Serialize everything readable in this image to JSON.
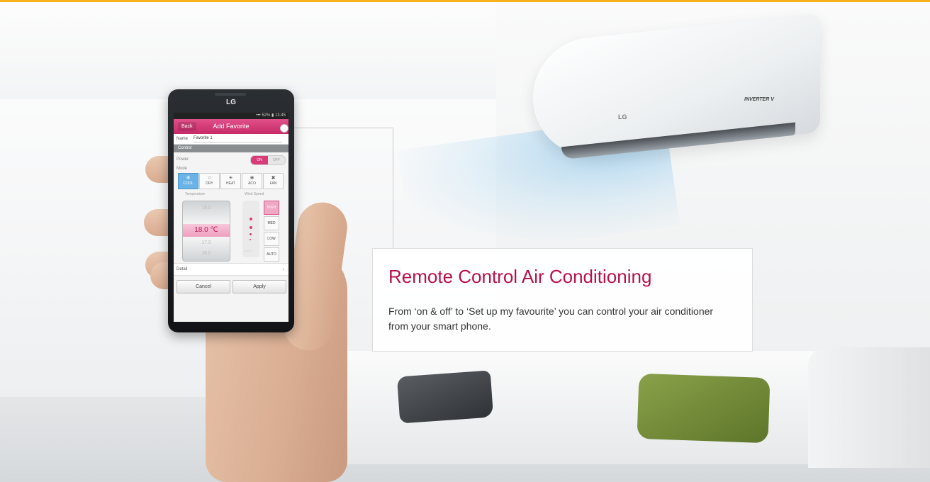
{
  "colors": {
    "top_bar": "#f6b11b",
    "accent": "#b8114a",
    "app_bar": "#d83b78",
    "mode_active": "#6bb3e6"
  },
  "air_conditioner": {
    "logo": "LG",
    "badge": "INVERTER V"
  },
  "info_panel": {
    "title": "Remote Control Air Conditioning",
    "description": "From ‘on & off’ to ‘Set up my favourite’ you can control your air conditioner  from your smart phone."
  },
  "phone": {
    "brand": "LG",
    "status": "••• 52% ▮ 13:45",
    "app_bar": {
      "back": "Back",
      "title": "Add Favorite"
    },
    "name": {
      "label": "Name",
      "value": "Favorite 1"
    },
    "section": "Control",
    "power": {
      "label": "Power",
      "on": "ON",
      "off": "OFF"
    },
    "mode": {
      "label": "Mode",
      "options": [
        {
          "label": "COOL",
          "icon": "snowflake-icon",
          "glyph": "❄"
        },
        {
          "label": "DRY",
          "icon": "droplet-icon",
          "glyph": "○"
        },
        {
          "label": "HEAT",
          "icon": "sun-icon",
          "glyph": "☀"
        },
        {
          "label": "ACO",
          "icon": "auto-icon",
          "glyph": "❀"
        },
        {
          "label": "FAN",
          "icon": "fan-icon",
          "glyph": "✖"
        }
      ],
      "selected": "COOL"
    },
    "temperature": {
      "label": "Temperature",
      "above": "19.0",
      "value": "18.0 ℃",
      "below": "17.0",
      "below2": "16.0"
    },
    "wind": {
      "label": "Wind Speed",
      "options": [
        "HIGH",
        "MED",
        "LOW",
        "AUTO"
      ],
      "selected": "HIGH",
      "dim_label": "AUTO"
    },
    "detail": {
      "label": "Detail",
      "chevron": "›"
    },
    "actions": {
      "cancel": "Cancel",
      "apply": "Apply"
    }
  }
}
